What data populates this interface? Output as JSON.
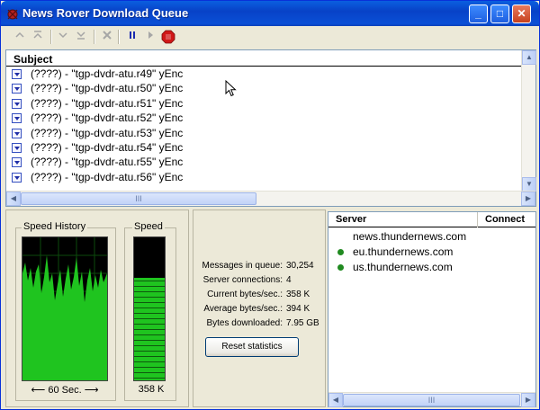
{
  "window": {
    "title": "News Rover Download Queue",
    "controls": {
      "minimize": "_",
      "maximize": "□",
      "close": "✕"
    }
  },
  "toolbar": {
    "items": [
      {
        "name": "move-top-icon",
        "glyph": "⤒",
        "enabled": false
      },
      {
        "name": "move-up-icon",
        "glyph": "⤒",
        "enabled": false
      },
      {
        "name": "move-down-icon",
        "glyph": "⌄",
        "enabled": false
      },
      {
        "name": "move-bottom-icon",
        "glyph": "⤓",
        "enabled": false
      },
      {
        "name": "delete-icon",
        "glyph": "✖",
        "enabled": false
      },
      {
        "name": "pause-icon",
        "glyph": "❚❚",
        "enabled": true
      },
      {
        "name": "play-icon",
        "glyph": "▶",
        "enabled": false
      },
      {
        "name": "stop-icon",
        "glyph": "■",
        "enabled": true
      }
    ]
  },
  "queue": {
    "column_subject": "Subject",
    "rows": [
      "(????) - \"tgp-dvdr-atu.r49\" yEnc",
      "(????) - \"tgp-dvdr-atu.r50\" yEnc",
      "(????) - \"tgp-dvdr-atu.r51\" yEnc",
      "(????) - \"tgp-dvdr-atu.r52\" yEnc",
      "(????) - \"tgp-dvdr-atu.r53\" yEnc",
      "(????) - \"tgp-dvdr-atu.r54\" yEnc",
      "(????) - \"tgp-dvdr-atu.r55\" yEnc",
      "(????) - \"tgp-dvdr-atu.r56\" yEnc"
    ],
    "scroll_thumb_glyph": "III"
  },
  "speed_history": {
    "label": "Speed History",
    "duration_label": "60 Sec.",
    "arrow_left": "⟵",
    "arrow_right": "⟶",
    "color": "#1fc41f"
  },
  "speed": {
    "label": "Speed",
    "value": "358 K",
    "level_fraction": 0.72
  },
  "stats": {
    "items": [
      {
        "label": "Messages in queue:",
        "value": "30,254"
      },
      {
        "label": "Server connections:",
        "value": "4"
      },
      {
        "label": "Current bytes/sec.:",
        "value": "358 K"
      },
      {
        "label": "Average bytes/sec.:",
        "value": "394 K"
      },
      {
        "label": "Bytes downloaded:",
        "value": "7.95 GB"
      }
    ],
    "reset_button": "Reset statistics"
  },
  "servers": {
    "col_server": "Server",
    "col_connect": "Connect",
    "rows": [
      {
        "name": "news.thundernews.com",
        "connected": false
      },
      {
        "name": "eu.thundernews.com",
        "connected": true
      },
      {
        "name": "us.thundernews.com",
        "connected": true
      }
    ],
    "scroll_thumb_glyph": "III"
  }
}
